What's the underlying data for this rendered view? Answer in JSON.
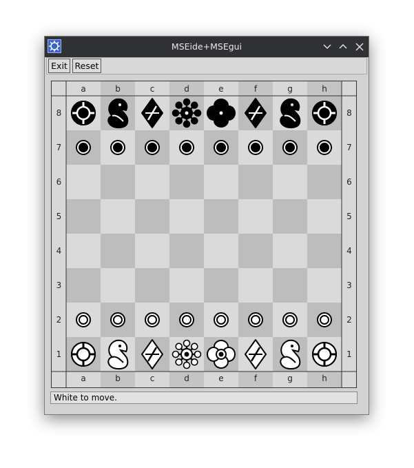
{
  "window": {
    "title": "MSEide+MSEgui"
  },
  "titlebar_buttons": [
    "minimize-icon",
    "maximize-icon",
    "close-icon"
  ],
  "toolbar": {
    "exit_label": "Exit",
    "reset_label": "Reset"
  },
  "board": {
    "files": [
      "a",
      "b",
      "c",
      "d",
      "e",
      "f",
      "g",
      "h"
    ],
    "ranks": [
      "8",
      "7",
      "6",
      "5",
      "4",
      "3",
      "2",
      "1"
    ],
    "light_square": "#dadada",
    "dark_square": "#bdbdbd",
    "pieces": {
      "8": [
        "rook",
        "knight",
        "bishop",
        "queen",
        "king",
        "bishop",
        "knight",
        "rook"
      ],
      "7": [
        "pawn",
        "pawn",
        "pawn",
        "pawn",
        "pawn",
        "pawn",
        "pawn",
        "pawn"
      ],
      "6": [
        "",
        "",
        "",
        "",
        "",
        "",
        "",
        ""
      ],
      "5": [
        "",
        "",
        "",
        "",
        "",
        "",
        "",
        ""
      ],
      "4": [
        "",
        "",
        "",
        "",
        "",
        "",
        "",
        ""
      ],
      "3": [
        "",
        "",
        "",
        "",
        "",
        "",
        "",
        ""
      ],
      "2": [
        "pawn",
        "pawn",
        "pawn",
        "pawn",
        "pawn",
        "pawn",
        "pawn",
        "pawn"
      ],
      "1": [
        "rook",
        "knight",
        "bishop",
        "queen",
        "king",
        "bishop",
        "knight",
        "rook"
      ]
    },
    "piece_colors": {
      "8": "black",
      "7": "black",
      "2": "white",
      "1": "white"
    }
  },
  "status": {
    "text": "White to move."
  }
}
